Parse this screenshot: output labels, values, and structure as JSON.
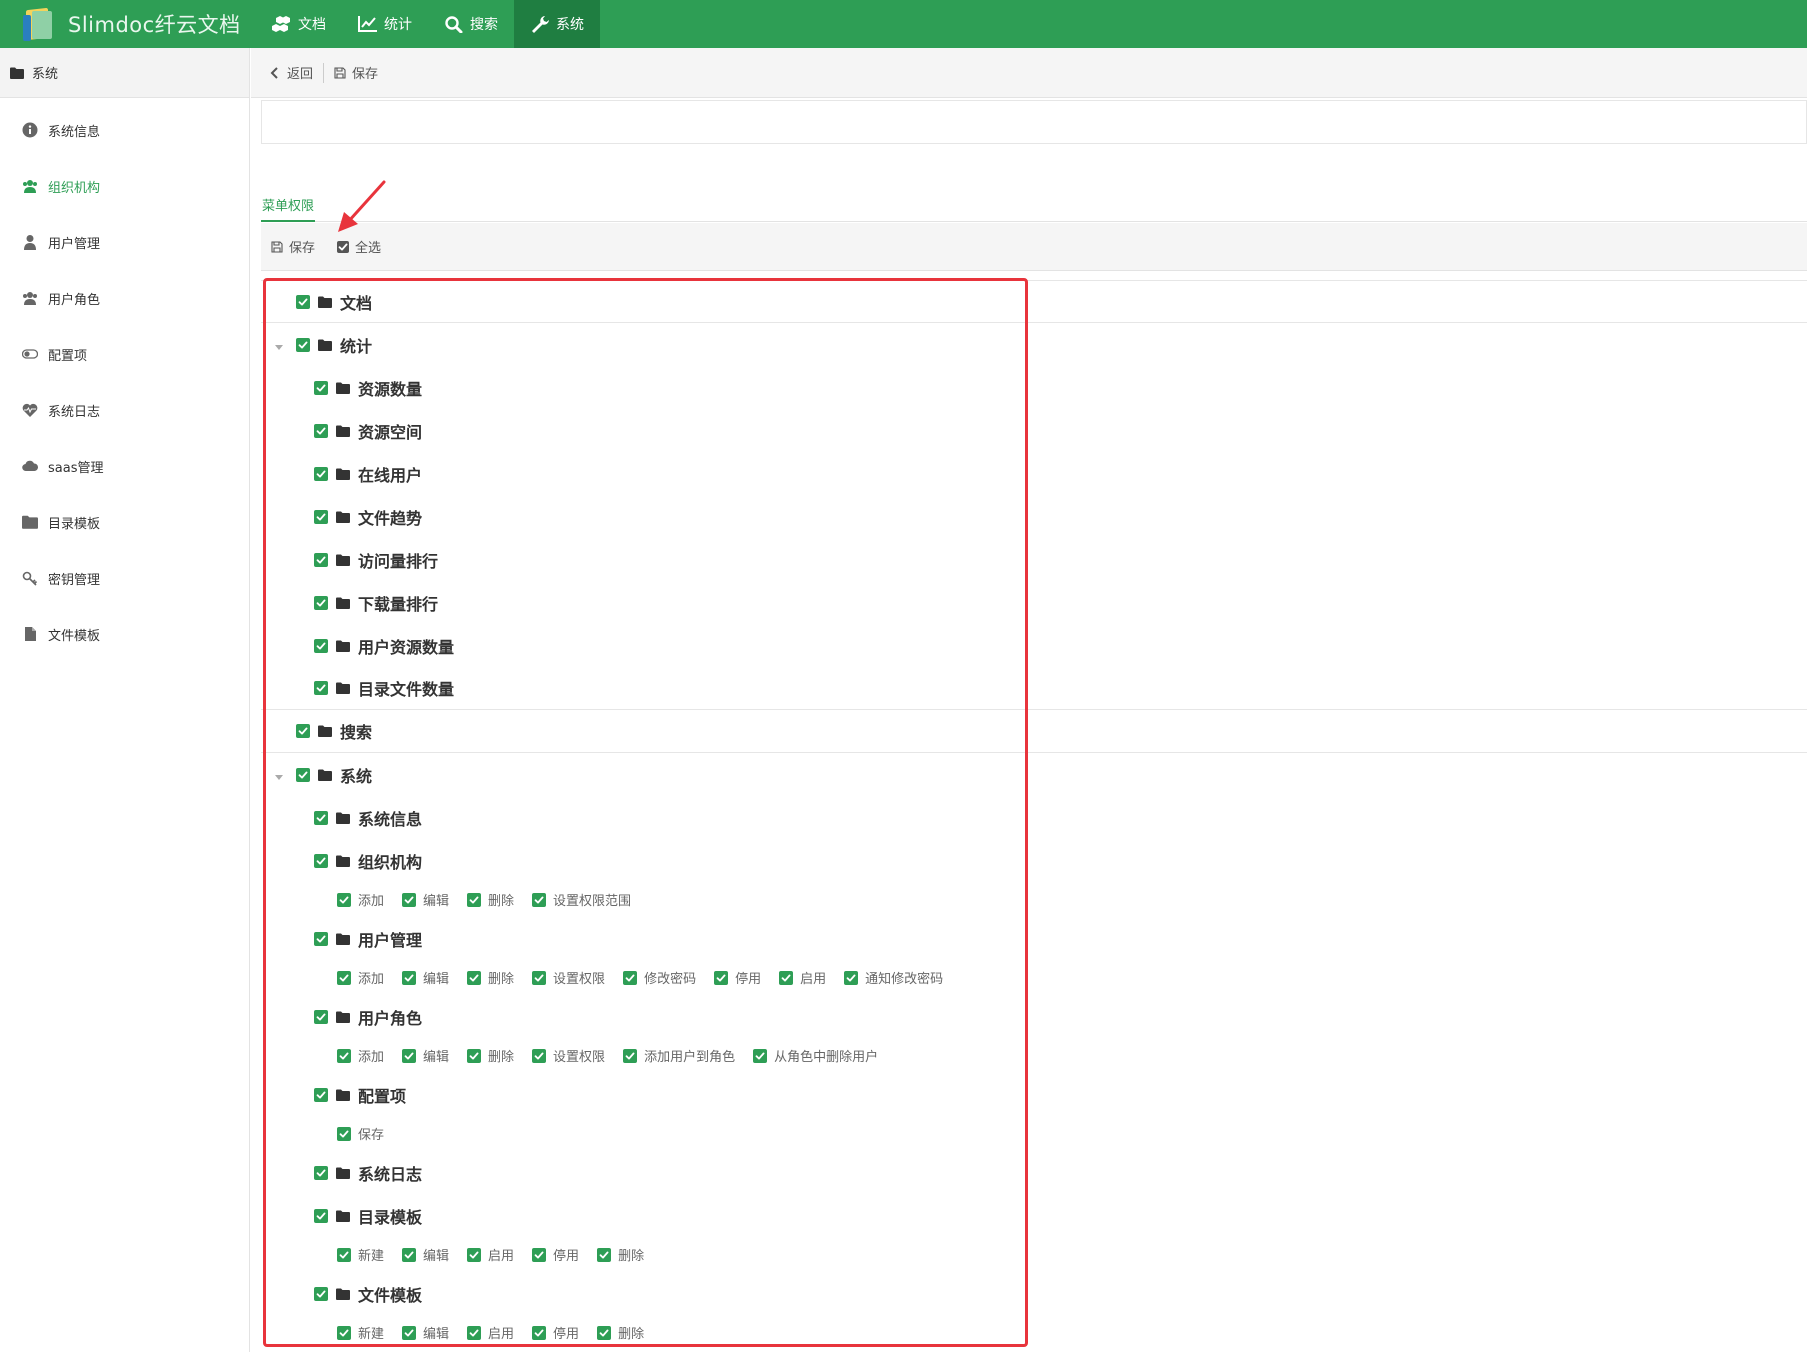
{
  "app": {
    "title": "Slimdoc纤云文档"
  },
  "topnav": [
    {
      "label": "文档",
      "icon": "cubes-icon",
      "active": false
    },
    {
      "label": "统计",
      "icon": "line-chart-icon",
      "active": false
    },
    {
      "label": "搜索",
      "icon": "search-icon",
      "active": false
    },
    {
      "label": "系统",
      "icon": "wrench-icon",
      "active": true
    }
  ],
  "sidebar": {
    "header": "系统",
    "items": [
      {
        "label": "系统信息",
        "icon": "info-circle-icon",
        "active": false
      },
      {
        "label": "组织机构",
        "icon": "users-icon",
        "active": true
      },
      {
        "label": "用户管理",
        "icon": "user-icon",
        "active": false
      },
      {
        "label": "用户角色",
        "icon": "users-icon",
        "active": false
      },
      {
        "label": "配置项",
        "icon": "toggle-icon",
        "active": false
      },
      {
        "label": "系统日志",
        "icon": "heartbeat-icon",
        "active": false
      },
      {
        "label": "saas管理",
        "icon": "cloud-icon",
        "active": false
      },
      {
        "label": "目录模板",
        "icon": "folder-icon",
        "active": false
      },
      {
        "label": "密钥管理",
        "icon": "key-icon",
        "active": false
      },
      {
        "label": "文件模板",
        "icon": "file-icon",
        "active": false
      }
    ]
  },
  "toolbar": {
    "back_label": "返回",
    "save_label": "保存"
  },
  "tabs": {
    "menu_permission": "菜单权限"
  },
  "perm_toolbar": {
    "save_label": "保存",
    "select_all_label": "全选"
  },
  "tree": {
    "doc": "文档",
    "stats": {
      "label": "统计",
      "children": [
        "资源数量",
        "资源空间",
        "在线用户",
        "文件趋势",
        "访问量排行",
        "下载量排行",
        "用户资源数量",
        "目录文件数量"
      ]
    },
    "search": "搜索",
    "system": {
      "label": "系统",
      "sys_info": "系统信息",
      "org": {
        "label": "组织机构",
        "actions": [
          "添加",
          "编辑",
          "删除",
          "设置权限范围"
        ]
      },
      "user_mgmt": {
        "label": "用户管理",
        "actions": [
          "添加",
          "编辑",
          "删除",
          "设置权限",
          "修改密码",
          "停用",
          "启用",
          "通知修改密码"
        ]
      },
      "user_role": {
        "label": "用户角色",
        "actions": [
          "添加",
          "编辑",
          "删除",
          "设置权限",
          "添加用户到角色",
          "从角色中删除用户"
        ]
      },
      "config": {
        "label": "配置项",
        "actions": [
          "保存"
        ]
      },
      "sys_log": "系统日志",
      "dir_template": {
        "label": "目录模板",
        "actions": [
          "新建",
          "编辑",
          "启用",
          "停用",
          "删除"
        ]
      },
      "file_template": {
        "label": "文件模板",
        "actions": [
          "新建",
          "编辑",
          "启用",
          "停用",
          "删除"
        ]
      }
    }
  },
  "colors": {
    "brand": "#2e9e55",
    "brand_dark": "#1f7e41",
    "highlight": "#e8343c"
  }
}
